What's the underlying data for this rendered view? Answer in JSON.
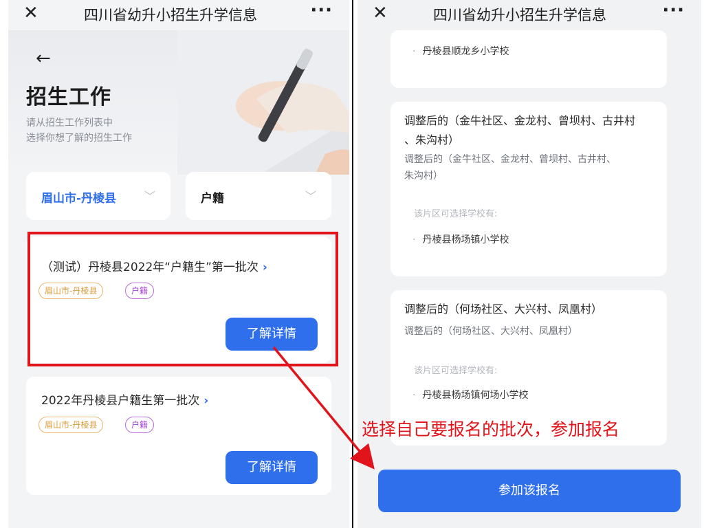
{
  "left": {
    "window_title": "四川省幼升小招生升学信息",
    "hero_title": "招生工作",
    "hero_sub1": "请从招生工作列表中",
    "hero_sub2": "选择你想了解的招生工作",
    "filter_region": "眉山市-丹棱县",
    "filter_type": "户籍",
    "cards": [
      {
        "title": "（测试）丹棱县2022年“户籍生”第一批次",
        "tag_region": "眉山市-丹棱县",
        "tag_type": "户籍",
        "button": "了解详情"
      },
      {
        "title": "2022年丹棱县户籍生第一批次",
        "tag_region": "眉山市-丹棱县",
        "tag_type": "户籍",
        "button": "了解详情"
      }
    ]
  },
  "right": {
    "window_title": "四川省幼升小招生升学信息",
    "top_school": "丹棱县顺龙乡小学校",
    "areas": [
      {
        "head_l1": "调整后的（金牛社区、金龙村、曾坝村、古井村",
        "head_l2": "、朱沟村）",
        "sub_l1": "调整后的（金牛社区、金龙村、曾坝村、古井村、",
        "sub_l2": "朱沟村）",
        "hint": "该片区可选择学校有:",
        "school": "丹棱县杨场镇小学校"
      },
      {
        "head_l1": "调整后的（何场社区、大兴村、凤凰村）",
        "sub_l1": "调整后的（何场社区、大兴村、凤凰村）",
        "hint": "该片区可选择学校有:",
        "school": "丹棱县杨场镇何场小学校"
      }
    ],
    "join_button": "参加该报名"
  },
  "annotation": "选择自己要报名的批次，参加报名",
  "colors": {
    "primary": "#2f6fec",
    "annotation_red": "#e0141a",
    "tag_region": "#d79c3a",
    "tag_huji": "#a13fd6"
  },
  "icons": {
    "close": "close-icon",
    "more": "more-icon",
    "back": "back-arrow-icon",
    "chevron": "chevron-down-icon"
  }
}
